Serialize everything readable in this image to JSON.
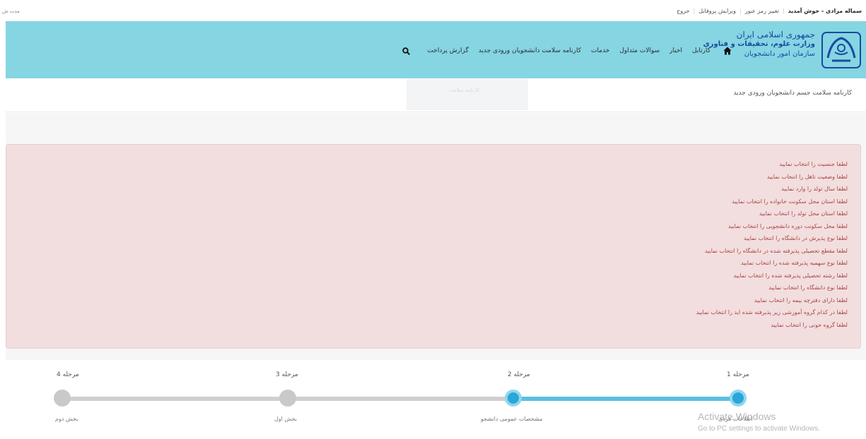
{
  "topbar": {
    "greeting": "سماله مرادی - خوش آمدید",
    "links": [
      "تغییر رمز عبور",
      "ویرایش پروفایل",
      "خروج"
    ],
    "session_text": "مدت ش"
  },
  "header": {
    "org_line1": "جمهوری اسلامی ایران",
    "org_line2": "وزارت علوم، تحقیقات و فناوری",
    "org_line3": "سازمان امور دانشجویان",
    "nav_items": [
      "کارتابل",
      "اخبار",
      "سوالات متداول",
      "خدمات",
      "کارنامه سلامت دانشجویان ورودی جدید",
      "گزارش پرداخت"
    ],
    "icons": {
      "home": "home-icon",
      "search": "search-icon",
      "logo": "emblem-logo"
    }
  },
  "breadcrumb": {
    "title": "کارنامه سلامت جسم دانشجویان ورودی جدید",
    "ghost_tab": "کارنامه سلامت"
  },
  "alert": {
    "messages": [
      "لطفا جنسیت را انتخاب نمایید",
      "لطفا وضعیت تاهل را انتخاب نمایید",
      "لطفا سال تولد را وارد نمایید",
      "لطفا استان محل سکونت خانواده را انتخاب نمایید",
      "لطفا استان محل تولد را انتخاب نمایید",
      "لطفا محل سکونت دوره دانشجویی را انتخاب نمایید",
      "لطفا نوع پذیرش در دانشگاه را انتخاب نمایید",
      "لطفا مقطع تحصیلی پذیرفته شده در دانشگاه را انتخاب نمایید",
      "لطفا نوع سهمیه پذیرفته شده را انتخاب نمایید",
      "لطفا رشته تحصیلی پذیرفته شده را انتخاب نمایید",
      "لطفا نوع دانشگاه را انتخاب نمایید",
      "لطفا دارای دفترچه بیمه را انتخاب نمایید",
      "لطفا در کدام گروه آموزشی زیر پذیرفته شده اید را انتخاب نمایید",
      "لطفا گروه خونی را انتخاب نمایید"
    ],
    "color": "#a94442"
  },
  "stepper": {
    "steps": [
      {
        "title": "مرحله 1",
        "subtitle": "اطلاعات فردی",
        "state": "done"
      },
      {
        "title": "مرحله 2",
        "subtitle": "مشخصات عمومی دانشجو",
        "state": "current"
      },
      {
        "title": "مرحله 3",
        "subtitle": "بخش اول",
        "state": "pending"
      },
      {
        "title": "مرحله 4",
        "subtitle": "بخش دوم",
        "state": "pending"
      }
    ],
    "active_color": "#2aa6d9",
    "inactive_color": "#c9c9c9"
  },
  "watermark": {
    "line1": "Activate Windows",
    "line2": "Go to PC settings to activate Windows."
  }
}
